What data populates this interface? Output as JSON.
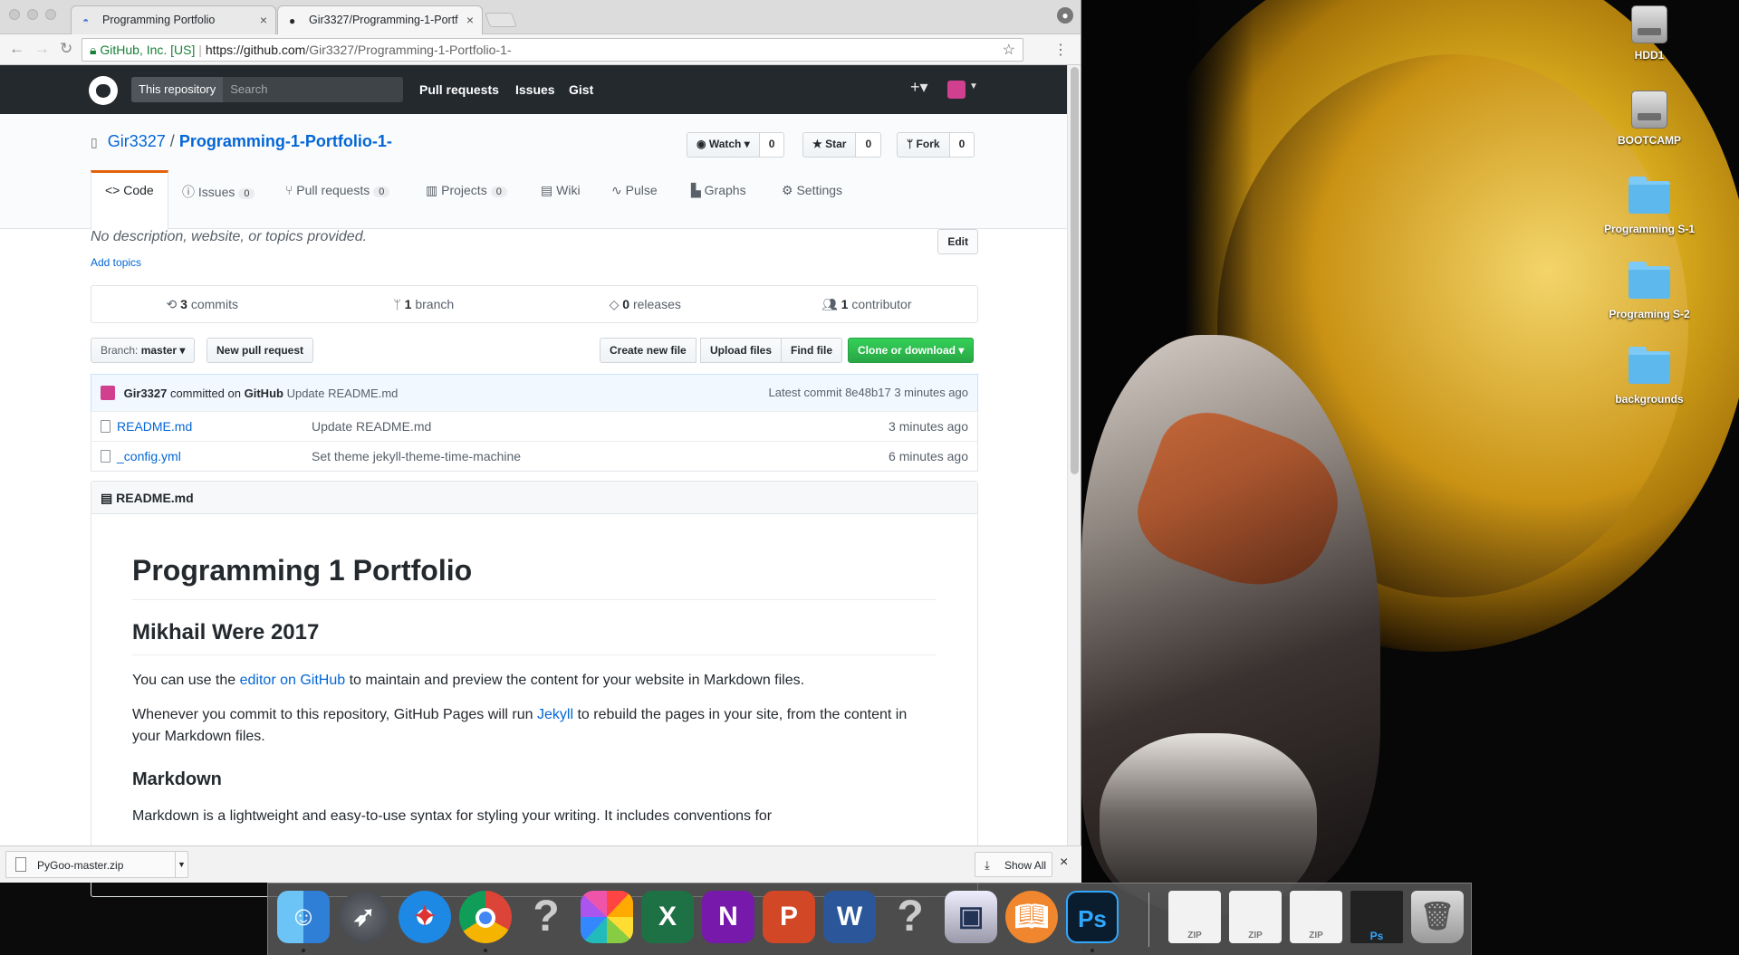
{
  "browser": {
    "tabs": [
      {
        "title": "Programming Portfolio",
        "active": false
      },
      {
        "title": "Gir3327/Programming-1-Portf",
        "active": true
      }
    ],
    "omnibox": {
      "security_label": "GitHub, Inc. [US]",
      "url_host": "https://github.com",
      "url_path": "/Gir3327/Programming-1-Portfolio-1-"
    }
  },
  "github_header": {
    "scope_label": "This repository",
    "search_placeholder": "Search",
    "nav": [
      "Pull requests",
      "Issues",
      "Gist"
    ],
    "plus_icon": "+▾"
  },
  "repo": {
    "owner": "Gir3327",
    "separator": "/",
    "name": "Programming-1-Portfolio-1-",
    "actions": {
      "watch": {
        "label": "Watch ▾",
        "count": "0"
      },
      "star": {
        "label": "Star",
        "count": "0"
      },
      "fork": {
        "label": "Fork",
        "count": "0"
      }
    },
    "nav": {
      "code": "Code",
      "issues": "Issues",
      "issues_count": "0",
      "pulls": "Pull requests",
      "pulls_count": "0",
      "projects": "Projects",
      "projects_count": "0",
      "wiki": "Wiki",
      "pulse": "Pulse",
      "graphs": "Graphs",
      "settings": "Settings"
    },
    "description": "No description, website, or topics provided.",
    "add_topics": "Add topics",
    "edit_label": "Edit",
    "summary": {
      "commits_n": "3",
      "commits_label": "commits",
      "branch_n": "1",
      "branch_label": "branch",
      "releases_n": "0",
      "releases_label": "releases",
      "contributor_n": "1",
      "contributor_label": "contributor"
    },
    "filebar": {
      "branch_prefix": "Branch:",
      "branch": "master ▾",
      "new_pr": "New pull request",
      "create_file": "Create new file",
      "upload": "Upload files",
      "find": "Find file",
      "clone": "Clone or download ▾"
    },
    "commit": {
      "author": "Gir3327",
      "committed_on": "committed on",
      "platform": "GitHub",
      "message": "Update README.md",
      "latest_label": "Latest commit",
      "sha": "8e48b17",
      "age": "3 minutes ago"
    },
    "files": [
      {
        "name": "README.md",
        "message": "Update README.md",
        "age": "3 minutes ago"
      },
      {
        "name": "_config.yml",
        "message": "Set theme jekyll-theme-time-machine",
        "age": "6 minutes ago"
      }
    ],
    "readme": {
      "header": "README.md",
      "h1": "Programming 1 Portfolio",
      "h2": "Mikhail Were 2017",
      "p1_before": "You can use the ",
      "p1_link": "editor on GitHub",
      "p1_after": " to maintain and preview the content for your website in Markdown files.",
      "p2_before": "Whenever you commit to this repository, GitHub Pages will run ",
      "p2_link": "Jekyll",
      "p2_after": " to rebuild the pages in your site, from the content in your Markdown files.",
      "h3": "Markdown",
      "p3": "Markdown is a lightweight and easy-to-use syntax for styling your writing. It includes conventions for"
    }
  },
  "downloads": {
    "file": "PyGoo-master.zip",
    "show_all": "Show All"
  },
  "desktop": {
    "icons": [
      "HDD1",
      "BOOTCAMP",
      "Programming S-1",
      "Programing S-2",
      "backgrounds"
    ]
  },
  "dock": {
    "apps": [
      "finder",
      "launchpad",
      "safari",
      "chrome",
      "unknown",
      "photos",
      "excel",
      "onenote",
      "powerpoint",
      "word",
      "unknown",
      "preview",
      "ibooks",
      "photoshop"
    ],
    "items_right": [
      "ZIP",
      "ZIP",
      "ZIP"
    ]
  },
  "colors": {
    "github_header": "#24292e",
    "link": "#0366d6",
    "clone_green": "#28a745",
    "tab_accent": "#e36209"
  }
}
